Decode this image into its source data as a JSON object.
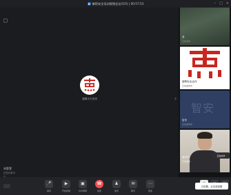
{
  "window": {
    "title": "御帮安全培训视频会议(5/5) | 00:57:53",
    "controls": [
      "–",
      "□",
      "×"
    ]
  },
  "stage": {
    "presenter_status": "摄像头已关闭",
    "name": "刘菲菲",
    "subtitle": "正在共享中",
    "mic": "◎"
  },
  "participants": [
    {
      "name": "勇",
      "sub": "正在发言"
    },
    {
      "name": "御帮安全合作",
      "sub": "正在发言中",
      "logo_text": "燕"
    },
    {
      "name": "智安",
      "sub": "正在发言中",
      "logo_text": "智安"
    },
    {
      "name": "董家安",
      "sub": "正在发言",
      "share_tag": "正在共享"
    }
  ],
  "toolbar": {
    "items": [
      {
        "label": "静音",
        "icon": "mic-icon",
        "glyph": "🎤"
      },
      {
        "label": "开启视频",
        "icon": "camera-icon",
        "glyph": "▶"
      },
      {
        "label": "共享屏幕",
        "icon": "share-icon",
        "glyph": "▣"
      },
      {
        "label": "结束",
        "icon": "hangup-icon",
        "glyph": "☎"
      },
      {
        "label": "成员",
        "icon": "members-icon",
        "glyph": "♟"
      },
      {
        "label": "聊天",
        "icon": "chat-icon",
        "glyph": "✉"
      },
      {
        "label": "更多",
        "icon": "more-icon",
        "glyph": "⋯"
      }
    ],
    "right": [
      {
        "icon": "grid-icon",
        "glyph": "▦"
      },
      {
        "icon": "layout-icon",
        "glyph": "▥"
      },
      {
        "icon": "fullscreen-icon",
        "glyph": "⛶"
      }
    ]
  },
  "popup": {
    "text": "已设置，点击请查看"
  },
  "colors": {
    "hangup": "#ff4d4f",
    "accent": "#3a7bd5",
    "logo_red": "#c8261f"
  }
}
